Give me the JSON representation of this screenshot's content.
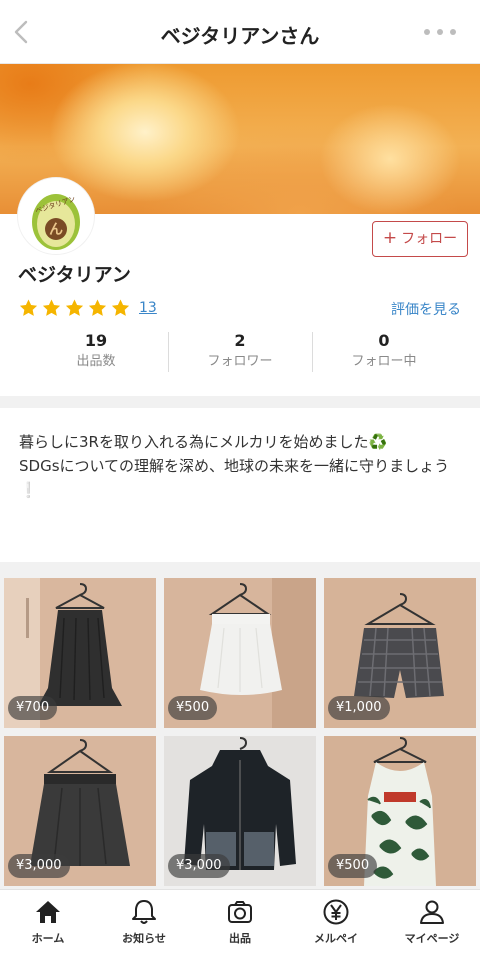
{
  "header": {
    "title": "ベジタリアンさん"
  },
  "profile": {
    "avatar_text": "ベジタリアン",
    "name": "ベジタリアン",
    "follow_label": "フォロー",
    "rating": 5,
    "review_count": "13",
    "see_reviews_label": "評価を見る"
  },
  "stats": [
    {
      "value": "19",
      "label": "出品数"
    },
    {
      "value": "2",
      "label": "フォロワー"
    },
    {
      "value": "0",
      "label": "フォロー中"
    }
  ],
  "bio": {
    "line1": "暮らしに3Rを取り入れる為にメルカリを始めました",
    "line1_emoji": "♻️",
    "line2": "SDGsについての理解を深め、地球の未来を一緒に守りましょう",
    "line2_emoji": "❕"
  },
  "items": [
    {
      "price": "¥700"
    },
    {
      "price": "¥500"
    },
    {
      "price": "¥1,000"
    },
    {
      "price": "¥3,000"
    },
    {
      "price": "¥3,000"
    },
    {
      "price": "¥500"
    }
  ],
  "tabs": [
    {
      "label": "ホーム"
    },
    {
      "label": "お知らせ"
    },
    {
      "label": "出品"
    },
    {
      "label": "メルペイ"
    },
    {
      "label": "マイページ"
    }
  ]
}
